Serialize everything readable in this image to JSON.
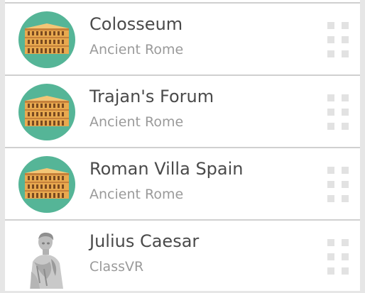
{
  "items": [
    {
      "title": "Colosseum",
      "subtitle": "Ancient Rome",
      "thumbnail_icon": "colosseum-icon"
    },
    {
      "title": "Trajan's Forum",
      "subtitle": "Ancient Rome",
      "thumbnail_icon": "colosseum-icon"
    },
    {
      "title": "Roman Villa Spain",
      "subtitle": "Ancient Rome",
      "thumbnail_icon": "colosseum-icon"
    },
    {
      "title": "Julius Caesar",
      "subtitle": "ClassVR",
      "thumbnail_icon": "statue-icon"
    }
  ],
  "colors": {
    "thumbnail_background": "#55b597",
    "title_text": "#4a4a4a",
    "subtitle_text": "#9a9a9a",
    "drag_handle": "#e2e2e2"
  }
}
